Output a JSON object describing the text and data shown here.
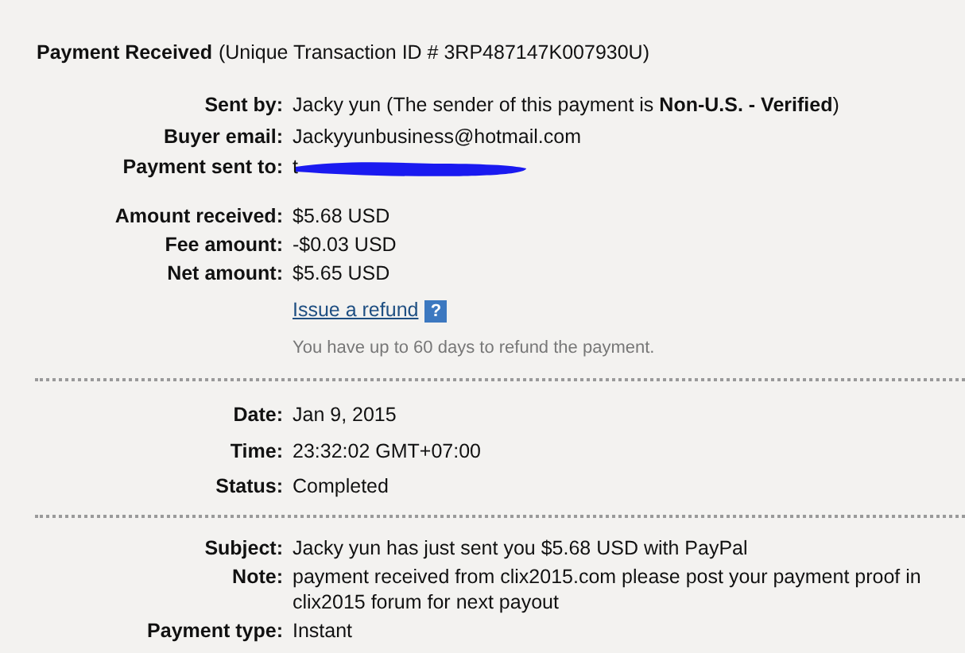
{
  "header": {
    "title": "Payment Received",
    "detail": "(Unique Transaction ID # 3RP487147K007930U)"
  },
  "sections": [
    {
      "rows": [
        {
          "kind": "field",
          "label": "Sent by:",
          "value": "Jacky yun (The sender of this payment is **Non-U.S. - Verified**)"
        },
        {
          "kind": "field",
          "label": "Buyer email:",
          "value": "Jackyyunbusiness@hotmail.com"
        },
        {
          "kind": "field",
          "label": "Payment sent to:",
          "value": "t",
          "redacted": true
        },
        {
          "kind": "field",
          "label": "Amount received:",
          "value": "$5.68 USD"
        },
        {
          "kind": "field",
          "label": "Fee amount:",
          "value": "-$0.03 USD"
        },
        {
          "kind": "field",
          "label": "Net amount:",
          "value": "$5.65 USD"
        },
        {
          "kind": "link",
          "link": "Issue a refund",
          "help": "?"
        },
        {
          "kind": "hint",
          "text": "You have up to 60 days to refund the payment."
        }
      ]
    },
    {
      "rows": [
        {
          "kind": "field",
          "label": "Date:",
          "value": "Jan 9, 2015"
        },
        {
          "kind": "field",
          "label": "Time:",
          "value": "23:32:02 GMT+07:00"
        },
        {
          "kind": "field",
          "label": "Status:",
          "value": "Completed"
        }
      ]
    },
    {
      "rows": [
        {
          "kind": "field",
          "label": "Subject:",
          "value": "Jacky yun has just sent you $5.68 USD with PayPal"
        },
        {
          "kind": "field",
          "label": "Note:",
          "value": "payment received from clix2015.com please post your payment proof in clix2015 forum for next payout"
        },
        {
          "kind": "field",
          "label": "Payment type:",
          "value": "Instant"
        }
      ]
    }
  ]
}
